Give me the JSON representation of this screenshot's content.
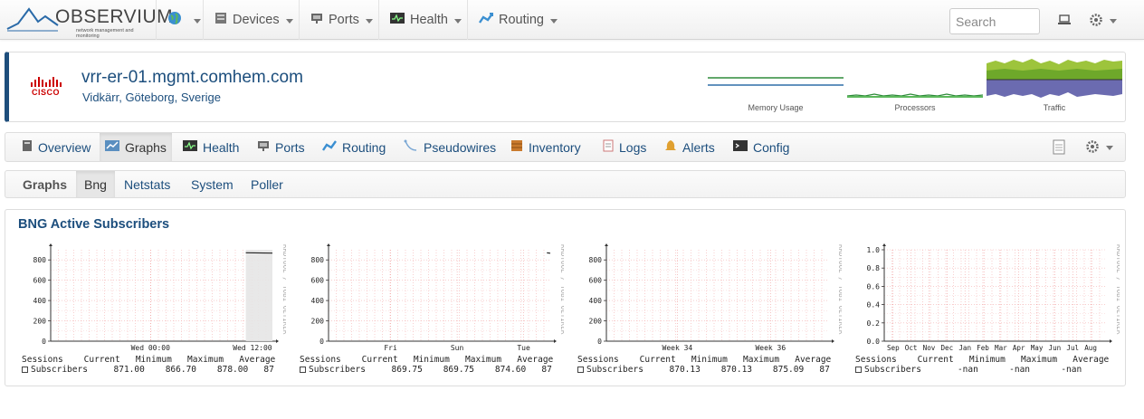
{
  "navbar": {
    "logo_text": "OBSERVIUM",
    "logo_subtext": "network management and monitoring",
    "items": [
      {
        "label": "",
        "icon": "globe-icon"
      },
      {
        "label": "Devices",
        "icon": "server-icon"
      },
      {
        "label": "Ports",
        "icon": "network-port-icon"
      },
      {
        "label": "Health",
        "icon": "health-monitor-icon"
      },
      {
        "label": "Routing",
        "icon": "routing-icon"
      }
    ],
    "search_placeholder": "Search"
  },
  "device": {
    "name": "vrr-er-01.mgmt.comhem.com",
    "location": "Vidkärr, Göteborg, Sverige",
    "vendor_logo": "CISCO",
    "mini_graphs": [
      {
        "label": "Memory Usage"
      },
      {
        "label": "Processors"
      },
      {
        "label": "Traffic"
      }
    ]
  },
  "tabs": [
    {
      "label": "Overview",
      "icon": "server-icon"
    },
    {
      "label": "Graphs",
      "icon": "graphs-icon",
      "active": true
    },
    {
      "label": "Health",
      "icon": "health-monitor-icon"
    },
    {
      "label": "Ports",
      "icon": "network-port-icon"
    },
    {
      "label": "Routing",
      "icon": "routing-icon"
    },
    {
      "label": "Pseudowires",
      "icon": "pseudowire-icon"
    },
    {
      "label": "Inventory",
      "icon": "inventory-icon"
    },
    {
      "label": "Logs",
      "icon": "logs-icon"
    },
    {
      "label": "Alerts",
      "icon": "bell-icon"
    },
    {
      "label": "Config",
      "icon": "terminal-icon"
    }
  ],
  "subtabs": {
    "heading": "Graphs",
    "items": [
      {
        "label": "Bng",
        "active": true
      },
      {
        "label": "Netstats"
      },
      {
        "label": "System"
      },
      {
        "label": "Poller"
      }
    ]
  },
  "panel": {
    "title": "BNG Active Subscribers"
  },
  "chart_data": [
    {
      "type": "line",
      "ylim": [
        0,
        900
      ],
      "y_ticks": [
        "0",
        "200",
        "400",
        "600",
        "800"
      ],
      "x_ticks": [
        "Wed 00:00",
        "Wed 12:00"
      ],
      "watermark": "RRDTOOL / TOBI OETIKER",
      "series": [
        {
          "name": "Subscribers",
          "x": [
            0.88,
            1.0
          ],
          "values": [
            871,
            867
          ]
        }
      ],
      "legend": {
        "header": [
          "Sessions",
          "Current",
          "Minimum",
          "Maximum",
          "Average"
        ],
        "row": [
          "Subscribers",
          "871.00",
          "866.70",
          "878.00",
          "87"
        ]
      }
    },
    {
      "type": "line",
      "ylim": [
        0,
        900
      ],
      "y_ticks": [
        "0",
        "200",
        "400",
        "600",
        "800"
      ],
      "x_ticks": [
        "Fri",
        "Sun",
        "Tue"
      ],
      "watermark": "RRDTOOL / TOBI OETIKER",
      "series": [
        {
          "name": "Subscribers",
          "x": [
            0.985,
            1.0
          ],
          "values": [
            870,
            866
          ]
        }
      ],
      "legend": {
        "header": [
          "Sessions",
          "Current",
          "Minimum",
          "Maximum",
          "Average"
        ],
        "row": [
          "Subscribers",
          "869.75",
          "869.75",
          "874.60",
          "87"
        ]
      }
    },
    {
      "type": "line",
      "ylim": [
        0,
        900
      ],
      "y_ticks": [
        "0",
        "200",
        "400",
        "600",
        "800"
      ],
      "x_ticks": [
        "Week 34",
        "Week 36"
      ],
      "watermark": "RRDTOOL / TOBI OETIKER",
      "series": [
        {
          "name": "Subscribers",
          "x": [],
          "values": []
        }
      ],
      "legend": {
        "header": [
          "Sessions",
          "Current",
          "Minimum",
          "Maximum",
          "Average"
        ],
        "row": [
          "Subscribers",
          "870.13",
          "870.13",
          "875.09",
          "87"
        ]
      }
    },
    {
      "type": "line",
      "ylim": [
        0,
        1.0
      ],
      "y_ticks": [
        "0.0",
        "0.2",
        "0.4",
        "0.6",
        "0.8",
        "1.0"
      ],
      "x_ticks": [
        "Sep",
        "Oct",
        "Nov",
        "Dec",
        "Jan",
        "Feb",
        "Mar",
        "Apr",
        "May",
        "Jun",
        "Jul",
        "Aug"
      ],
      "watermark": "RRDTOOL / TOBI OETIKER",
      "series": [
        {
          "name": "Subscribers",
          "x": [],
          "values": []
        }
      ],
      "legend": {
        "header": [
          "Sessions",
          "Current",
          "Minimum",
          "Maximum",
          "Average"
        ],
        "row": [
          "Subscribers",
          "-nan",
          "-nan",
          "-nan",
          ""
        ]
      }
    }
  ]
}
